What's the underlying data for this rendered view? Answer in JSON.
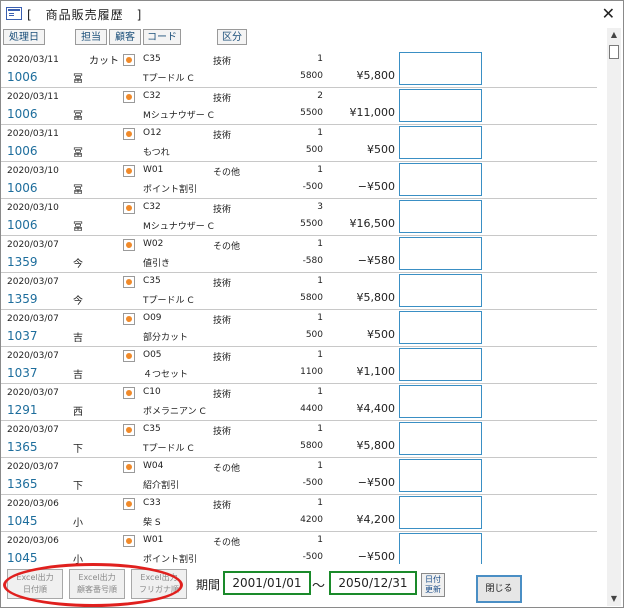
{
  "window": {
    "title": "[　商品販売履歴　]"
  },
  "header": {
    "buttons": [
      {
        "label": "処理日"
      },
      {
        "label": "担当"
      },
      {
        "label": "顧客"
      },
      {
        "label": "コード"
      },
      {
        "label": "区分"
      }
    ],
    "cut_label": "カット"
  },
  "records": [
    {
      "date": "2020/03/11",
      "customer_no": "1006",
      "customer_name": "冨",
      "code": "C35",
      "category": "技術",
      "qty": "1",
      "product": "Tプードル C",
      "price": "5800",
      "amount": "¥5,800"
    },
    {
      "date": "2020/03/11",
      "customer_no": "1006",
      "customer_name": "冨",
      "code": "C32",
      "category": "技術",
      "qty": "2",
      "product": "Mシュナウザー C",
      "price": "5500",
      "amount": "¥11,000"
    },
    {
      "date": "2020/03/11",
      "customer_no": "1006",
      "customer_name": "冨",
      "code": "O12",
      "category": "技術",
      "qty": "1",
      "product": "もつれ",
      "price": "500",
      "amount": "¥500"
    },
    {
      "date": "2020/03/10",
      "customer_no": "1006",
      "customer_name": "冨",
      "code": "W01",
      "category": "その他",
      "qty": "1",
      "product": "ポイント割引",
      "price": "-500",
      "amount": "−¥500"
    },
    {
      "date": "2020/03/10",
      "customer_no": "1006",
      "customer_name": "冨",
      "code": "C32",
      "category": "技術",
      "qty": "3",
      "product": "Mシュナウザー C",
      "price": "5500",
      "amount": "¥16,500"
    },
    {
      "date": "2020/03/07",
      "customer_no": "1359",
      "customer_name": "今",
      "code": "W02",
      "category": "その他",
      "qty": "1",
      "product": "値引き",
      "price": "-580",
      "amount": "−¥580"
    },
    {
      "date": "2020/03/07",
      "customer_no": "1359",
      "customer_name": "今",
      "code": "C35",
      "category": "技術",
      "qty": "1",
      "product": "Tプードル C",
      "price": "5800",
      "amount": "¥5,800"
    },
    {
      "date": "2020/03/07",
      "customer_no": "1037",
      "customer_name": "吉",
      "code": "O09",
      "category": "技術",
      "qty": "1",
      "product": "部分カット",
      "price": "500",
      "amount": "¥500"
    },
    {
      "date": "2020/03/07",
      "customer_no": "1037",
      "customer_name": "吉",
      "code": "O05",
      "category": "技術",
      "qty": "1",
      "product": "４つセット",
      "price": "1100",
      "amount": "¥1,100"
    },
    {
      "date": "2020/03/07",
      "customer_no": "1291",
      "customer_name": "西",
      "code": "C10",
      "category": "技術",
      "qty": "1",
      "product": "ポメラニアン C",
      "price": "4400",
      "amount": "¥4,400"
    },
    {
      "date": "2020/03/07",
      "customer_no": "1365",
      "customer_name": "下",
      "code": "C35",
      "category": "技術",
      "qty": "1",
      "product": "Tプードル C",
      "price": "5800",
      "amount": "¥5,800"
    },
    {
      "date": "2020/03/07",
      "customer_no": "1365",
      "customer_name": "下",
      "code": "W04",
      "category": "その他",
      "qty": "1",
      "product": "紹介割引",
      "price": "-500",
      "amount": "−¥500"
    },
    {
      "date": "2020/03/06",
      "customer_no": "1045",
      "customer_name": "小",
      "code": "C33",
      "category": "技術",
      "qty": "1",
      "product": "柴 S",
      "price": "4200",
      "amount": "¥4,200"
    },
    {
      "date": "2020/03/06",
      "customer_no": "1045",
      "customer_name": "小",
      "code": "W01",
      "category": "その他",
      "qty": "1",
      "product": "ポイント割引",
      "price": "-500",
      "amount": "−¥500"
    }
  ],
  "footer": {
    "excel_buttons": [
      {
        "line1": "Excel出力",
        "line2": "日付順"
      },
      {
        "line1": "Excel出力",
        "line2": "顧客番号順"
      },
      {
        "line1": "Excel出力",
        "line2": "フリガナ順"
      }
    ],
    "period_label": "期間",
    "date_from": "2001/01/01",
    "tilde": "〜",
    "date_to": "2050/12/31",
    "update_line1": "日付",
    "update_line2": "更新",
    "close_label": "閉じる"
  },
  "colors": {
    "highlight_oval": "#e0201e",
    "date_box_border": "#1a8a2a",
    "customer_no": "#1d6d9c"
  }
}
